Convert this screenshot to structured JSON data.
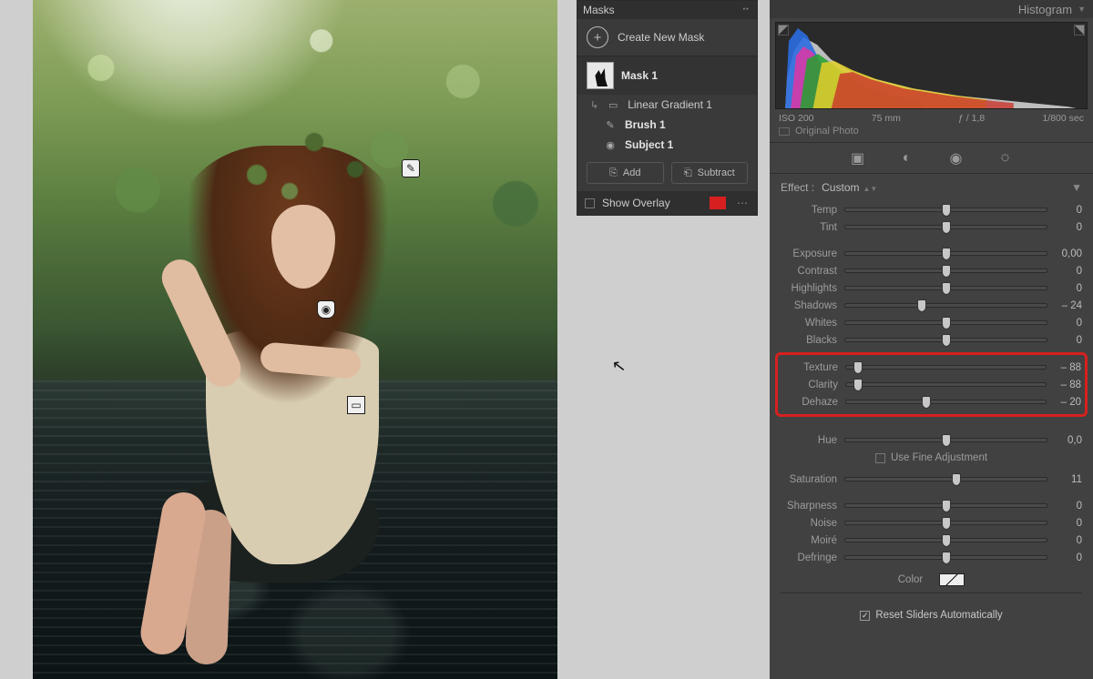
{
  "masks_panel": {
    "title": "Masks",
    "create_label": "Create New Mask",
    "mask_name": "Mask 1",
    "components": {
      "gradient": "Linear Gradient 1",
      "brush": "Brush 1",
      "subject": "Subject 1"
    },
    "buttons": {
      "add": "Add",
      "subtract": "Subtract"
    },
    "show_overlay": "Show Overlay",
    "overlay_color": "#d81f1f"
  },
  "histogram": {
    "title": "Histogram",
    "meta": {
      "iso": "ISO 200",
      "focal": "75 mm",
      "aperture": "ƒ / 1,8",
      "shutter": "1/800 sec"
    },
    "original": "Original Photo"
  },
  "tools": {
    "crop": "crop",
    "heal": "heal",
    "redeye": "redeye",
    "mask": "mask"
  },
  "effect": {
    "label": "Effect :",
    "value": "Custom"
  },
  "sliders": {
    "temp": {
      "label": "Temp",
      "value": "0",
      "min": -100,
      "max": 100,
      "pos": 50
    },
    "tint": {
      "label": "Tint",
      "value": "0",
      "min": -100,
      "max": 100,
      "pos": 50
    },
    "exposure": {
      "label": "Exposure",
      "value": "0,00",
      "min": -5,
      "max": 5,
      "pos": 50
    },
    "contrast": {
      "label": "Contrast",
      "value": "0",
      "min": -100,
      "max": 100,
      "pos": 50
    },
    "highlights": {
      "label": "Highlights",
      "value": "0",
      "min": -100,
      "max": 100,
      "pos": 50
    },
    "shadows": {
      "label": "Shadows",
      "value": "– 24",
      "min": -100,
      "max": 100,
      "pos": 38
    },
    "whites": {
      "label": "Whites",
      "value": "0",
      "min": -100,
      "max": 100,
      "pos": 50
    },
    "blacks": {
      "label": "Blacks",
      "value": "0",
      "min": -100,
      "max": 100,
      "pos": 50
    },
    "texture": {
      "label": "Texture",
      "value": "– 88",
      "min": -100,
      "max": 100,
      "pos": 6
    },
    "clarity": {
      "label": "Clarity",
      "value": "– 88",
      "min": -100,
      "max": 100,
      "pos": 6
    },
    "dehaze": {
      "label": "Dehaze",
      "value": "– 20",
      "min": -100,
      "max": 100,
      "pos": 40
    },
    "hue": {
      "label": "Hue",
      "value": "0,0",
      "min": -180,
      "max": 180,
      "pos": 50
    },
    "saturation": {
      "label": "Saturation",
      "value": "11",
      "min": -100,
      "max": 100,
      "pos": 55
    },
    "sharpness": {
      "label": "Sharpness",
      "value": "0",
      "min": 0,
      "max": 100,
      "pos": 50
    },
    "noise": {
      "label": "Noise",
      "value": "0",
      "min": 0,
      "max": 100,
      "pos": 50
    },
    "moire": {
      "label": "Moiré",
      "value": "0",
      "min": 0,
      "max": 100,
      "pos": 50
    },
    "defringe": {
      "label": "Defringe",
      "value": "0",
      "min": 0,
      "max": 100,
      "pos": 50
    }
  },
  "usefine": "Use Fine Adjustment",
  "color_label": "Color",
  "reset_label": "Reset Sliders Automatically"
}
